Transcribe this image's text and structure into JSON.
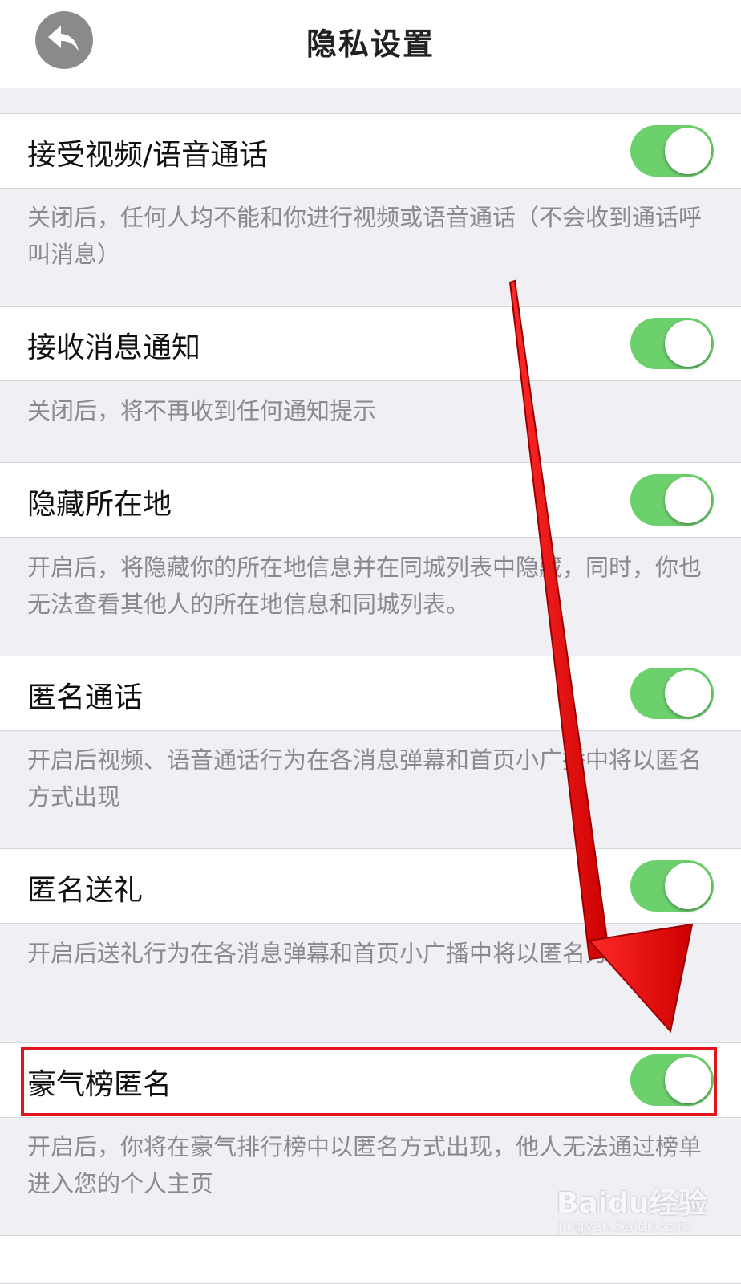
{
  "header": {
    "title": "隐私设置",
    "back_icon": "back-arrow-icon"
  },
  "settings": [
    {
      "label": "接受视频/语音通话",
      "enabled": true,
      "desc": "关闭后，任何人均不能和你进行视频或语音通话（不会收到通话呼叫消息）"
    },
    {
      "label": "接收消息通知",
      "enabled": true,
      "desc": "关闭后，将不再收到任何通知提示"
    },
    {
      "label": "隐藏所在地",
      "enabled": true,
      "desc": "开启后，将隐藏你的所在地信息并在同城列表中隐藏，同时，你也无法查看其他人的所在地信息和同城列表。"
    },
    {
      "label": "匿名通话",
      "enabled": true,
      "desc": "开启后视频、语音通话行为在各消息弹幕和首页小广播中将以匿名方式出现"
    },
    {
      "label": "匿名送礼",
      "enabled": true,
      "desc": "开启后送礼行为在各消息弹幕和首页小广播中将以匿名方式出现"
    },
    {
      "label": "豪气榜匿名",
      "enabled": true,
      "desc": "开启后，你将在豪气排行榜中以匿名方式出现，他人无法通过榜单进入您的个人主页"
    }
  ],
  "colors": {
    "toggle_on": "#6cd06c",
    "highlight_annotation": "#e3141b",
    "description_text": "#8a8a8f",
    "background": "#efeff4"
  },
  "watermark": {
    "logo": "Baidu经验",
    "sub": "jingyan.baidu.com"
  }
}
